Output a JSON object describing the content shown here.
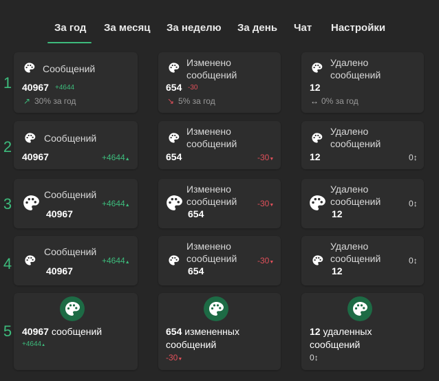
{
  "tabs": [
    {
      "label": "За год",
      "active": true
    },
    {
      "label": "За месяц"
    },
    {
      "label": "За неделю"
    },
    {
      "label": "За день"
    },
    {
      "label": "Чат"
    },
    {
      "label": "Настройки"
    }
  ],
  "colors": {
    "accent": "#3dbb7c",
    "negative": "#e0505a",
    "card": "#2d2d2d",
    "background": "#262626"
  },
  "icons": {
    "palette": "palette-icon",
    "trend_up": "trend-up-icon",
    "trend_down": "trend-down-icon",
    "trend_flat": "trend-flat-icon",
    "arrow": "arrow-icon"
  },
  "rows": [
    "1",
    "2",
    "3",
    "4",
    "5"
  ],
  "row1": {
    "messages": {
      "label": "Сообщений",
      "value": "40967",
      "delta": "+4644",
      "trend": "30% за год"
    },
    "changed": {
      "label1": "Изменено",
      "label2": "сообщений",
      "value": "654",
      "delta": "-30",
      "trend": "5% за год"
    },
    "deleted": {
      "label1": "Удалено",
      "label2": "сообщений",
      "value": "12",
      "trend": "0% за год"
    }
  },
  "row2": {
    "messages": {
      "label": "Сообщений",
      "value": "40967",
      "delta": "+4644"
    },
    "changed": {
      "label1": "Изменено",
      "label2": "сообщений",
      "value": "654",
      "delta": "-30"
    },
    "deleted": {
      "label1": "Удалено",
      "label2": "сообщений",
      "value": "12",
      "delta": "0"
    }
  },
  "row3": {
    "messages": {
      "label": "Сообщений",
      "value": "40967",
      "delta": "+4644"
    },
    "changed": {
      "label1": "Изменено",
      "label2": "сообщений",
      "value": "654",
      "delta": "-30"
    },
    "deleted": {
      "label1": "Удалено",
      "label2": "сообщений",
      "value": "12",
      "delta": "0"
    }
  },
  "row4": {
    "messages": {
      "label": "Сообщений",
      "value": "40967",
      "delta": "+4644"
    },
    "changed": {
      "label1": "Изменено",
      "label2": "сообщений",
      "value": "654",
      "delta": "-30"
    },
    "deleted": {
      "label1": "Удалено",
      "label2": "сообщений",
      "value": "12",
      "delta": "0"
    }
  },
  "row5": {
    "messages": {
      "value": "40967",
      "unit": "сообщений",
      "delta": "+4644"
    },
    "changed": {
      "value": "654",
      "unit": "измененных",
      "unit2": "сообщений",
      "delta": "-30"
    },
    "deleted": {
      "value": "12",
      "unit": "удаленных",
      "unit2": "сообщений",
      "delta": "0"
    }
  }
}
